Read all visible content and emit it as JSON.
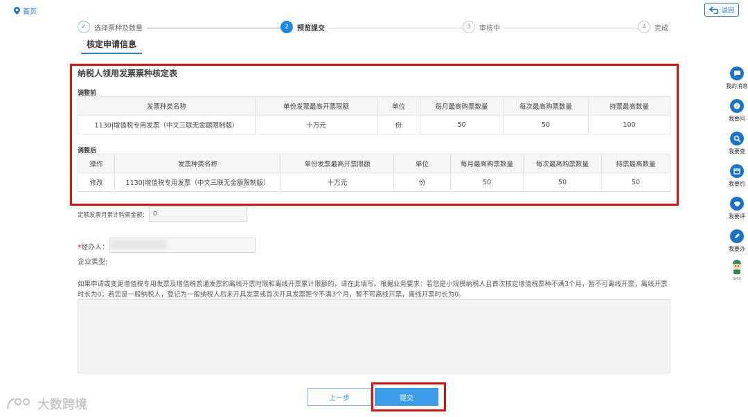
{
  "nav": {
    "home_label": "首页",
    "back_label": "返回"
  },
  "steps": [
    {
      "num": "✓",
      "label": "选择票种及数量"
    },
    {
      "num": "2",
      "label": "预览提交"
    },
    {
      "num": "3",
      "label": "审核中"
    },
    {
      "num": "4",
      "label": "完成"
    }
  ],
  "section_tab": "核定申请信息",
  "form": {
    "title": "纳税人领用发票票种核定表",
    "before": {
      "label": "调整前",
      "headers": [
        "发票种类名称",
        "单份发票最高开票限额",
        "单位",
        "每月最高购票数量",
        "每次最高购票数量",
        "持票最高数量"
      ],
      "rows": [
        [
          "1130|增值税专用发票（中文三联无金额限制版）",
          "十万元",
          "份",
          "50",
          "50",
          "100"
        ]
      ]
    },
    "after": {
      "label": "调整后",
      "headers": [
        "操作",
        "发票种类名称",
        "单份发票最高开票限额",
        "单位",
        "每月最高购票数量",
        "每次最高购票数量",
        "持票最高数量"
      ],
      "rows": [
        [
          "修改",
          "1130|增值税专用发票（中文三联无金额限制版）",
          "十万元",
          "份",
          "50",
          "50",
          "50"
        ]
      ]
    },
    "fixed_amount_label": "定额发票月累计购票金额：",
    "fixed_amount_value": "0",
    "handler_required": "*",
    "handler_label": "经办人：",
    "company_type_label": "企业类型:",
    "note": "如果申请或变更增值税专用发票及增值税普通发票的离线开票时限和离线开票累计限额的，请在此填写。根据业务要求：若您是小规模纳税人且首次核定增值税票种不满3个月，暂不可离线开票，离线开票时长为0；若您是一般纳税人，登记为一般纳税人后未开具发票或首次开具发票距今不满3个月，暂不可离线开票，离线开票时长为0。"
  },
  "buttons": {
    "prev": "上一步",
    "submit": "提交"
  },
  "sidebar": [
    {
      "label": "我的消息",
      "icon": "message-icon"
    },
    {
      "label": "我要问",
      "icon": "question-icon"
    },
    {
      "label": "我要查",
      "icon": "search-icon"
    },
    {
      "label": "我要约",
      "icon": "calendar-icon"
    },
    {
      "label": "我要评",
      "icon": "rate-icon"
    },
    {
      "label": "我要办",
      "icon": "edit-icon"
    }
  ],
  "mascot_label": "SHUI",
  "watermark": "大数跨境",
  "colors": {
    "accent": "#1a8be3",
    "highlight": "#e01010"
  }
}
